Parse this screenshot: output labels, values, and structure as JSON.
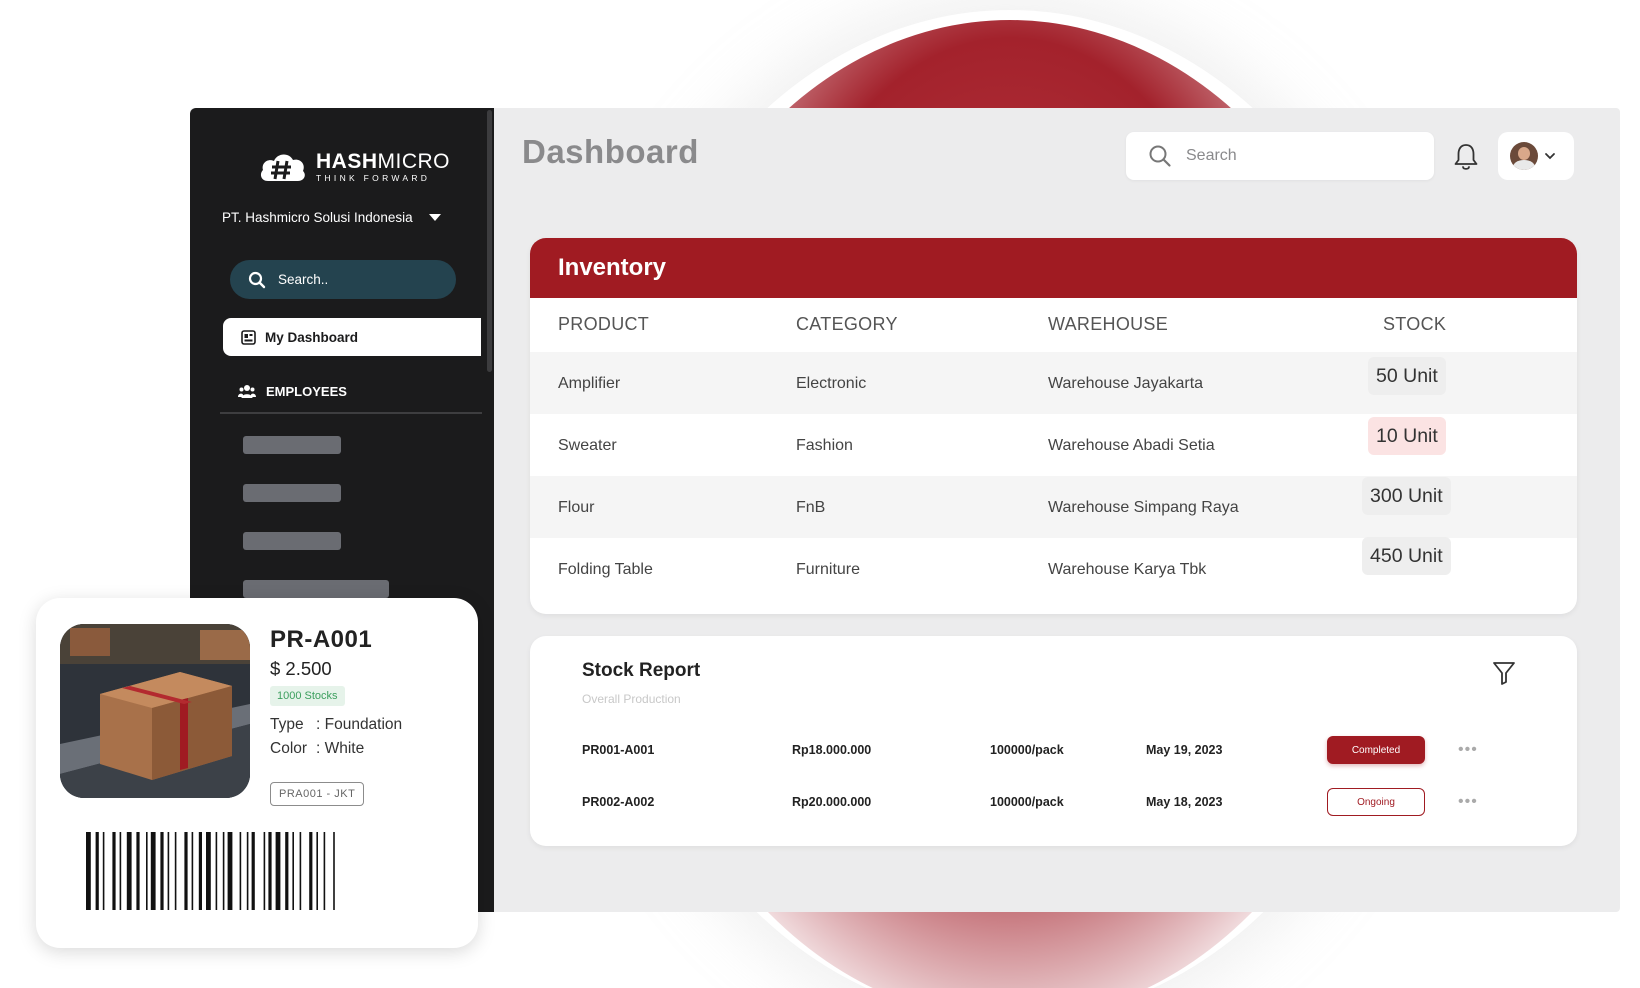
{
  "brand": {
    "name_bold": "HASH",
    "name_light": "MICRO",
    "tagline": "THINK FORWARD"
  },
  "sidebar": {
    "company": "PT. Hashmicro Solusi Indonesia",
    "search_placeholder": "Search..",
    "active_item": "My Dashboard",
    "section": "EMPLOYEES"
  },
  "header": {
    "title": "Dashboard",
    "search_placeholder": "Search"
  },
  "inventory": {
    "title": "Inventory",
    "columns": [
      "PRODUCT",
      "CATEGORY",
      "WAREHOUSE",
      "STOCK"
    ],
    "rows": [
      {
        "product": "Amplifier",
        "category": "Electronic",
        "warehouse": "Warehouse Jayakarta",
        "stock": "50 Unit",
        "stock_bg": "#eeeeee"
      },
      {
        "product": "Sweater",
        "category": "Fashion",
        "warehouse": "Warehouse Abadi Setia",
        "stock": "10 Unit",
        "stock_bg": "#fbe3e3"
      },
      {
        "product": "Flour",
        "category": "FnB",
        "warehouse": "Warehouse Simpang Raya",
        "stock": "300 Unit",
        "stock_bg": "#eeeeee"
      },
      {
        "product": "Folding Table",
        "category": "Furniture",
        "warehouse": "Warehouse Karya Tbk",
        "stock": "450 Unit",
        "stock_bg": "#eeeeee"
      }
    ]
  },
  "stock_report": {
    "title": "Stock Report",
    "subtitle": "Overall Production",
    "rows": [
      {
        "id": "PR001-A001",
        "amount": "Rp18.000.000",
        "qty": "100000/pack",
        "date": "May 19, 2023",
        "status": "Completed"
      },
      {
        "id": "PR002-A002",
        "amount": "Rp20.000.000",
        "qty": "100000/pack",
        "date": "May 18, 2023",
        "status": "Ongoing"
      }
    ]
  },
  "product_card": {
    "id": "PR-A001",
    "price": "$ 2.500",
    "stocks": "1000 Stocks",
    "type_label": "Type",
    "type_value": ": Foundation",
    "color_label": "Color",
    "color_value": ": White",
    "tag": "PRA001 - JKT"
  },
  "colors": {
    "accent": "#a01b22",
    "sidebar": "#1b1b1c",
    "search_pill": "#24434f",
    "success": "#3c9f5e"
  },
  "icons": [
    "hashmicro-logo-icon",
    "chevron-down-icon",
    "search-icon",
    "dashboard-icon",
    "employees-icon",
    "bell-icon",
    "avatar",
    "filter-icon",
    "more-icon",
    "barcode"
  ]
}
